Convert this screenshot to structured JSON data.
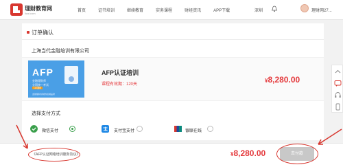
{
  "header": {
    "logo_text": "理财教育网",
    "logo_sub": "licai.com",
    "nav": [
      "首页",
      "证书培训",
      "继续教育",
      "实务课程",
      "财经资讯",
      "APP下载"
    ],
    "city": "深圳",
    "username": "理财网27..."
  },
  "page_title": "订单确认",
  "company": "上海当代金融培训有限公司",
  "order": {
    "thumb_title": "AFP",
    "thumb_line1": "金融理财师",
    "thumb_line2": "全国统一考试",
    "thumb_badge": "120课时",
    "thumb_foot": "金融理财领域的权威品牌",
    "course_name": "AFP认证培训",
    "validity": "课程有效期：120天",
    "price": "8,280.00",
    "currency": "¥"
  },
  "payment": {
    "title": "选择支付方式",
    "methods": [
      {
        "label": "微信支付",
        "icon": "wechat-pay-icon",
        "color": "#3a9f4b",
        "selected": true
      },
      {
        "label": "支付宝支付",
        "icon": "alipay-icon",
        "color": "#1e88e5",
        "selected": false
      },
      {
        "label": "银联在线",
        "icon": "unionpay-icon",
        "color": "#d8372f",
        "selected": false
      }
    ]
  },
  "bottom": {
    "agreement": "《AFP认证网络培训服务协议》",
    "total": "8,280.00",
    "currency": "¥",
    "pay_button": "去付款"
  },
  "colors": {
    "accent": "#e4393c",
    "annotation": "#d8372f"
  }
}
